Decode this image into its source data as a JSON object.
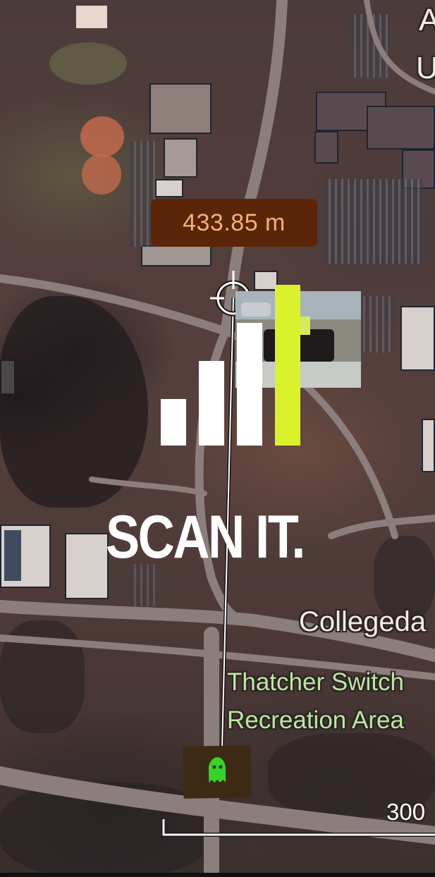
{
  "map": {
    "distance_readout": "433.85 m",
    "street_label": "Collegeda",
    "park_label_line1": "Thatcher Switch",
    "park_label_line2": "Recreation Area",
    "corner_label_line1": "A",
    "corner_label_line2": "U",
    "scale_label": "300"
  },
  "overlay": {
    "title": "SCAN IT.",
    "signal_bars_level": 4,
    "signal_bars_total": 4,
    "accent_color": "#d9f22c"
  },
  "colors": {
    "badge_background": "#5a2508",
    "badge_text": "#f3b07a",
    "park_label": "#b8e8a4",
    "ghost_marker": "#3ad12a"
  },
  "icons": {
    "crosshair": "crosshair-icon",
    "ghost": "ghost-icon"
  }
}
